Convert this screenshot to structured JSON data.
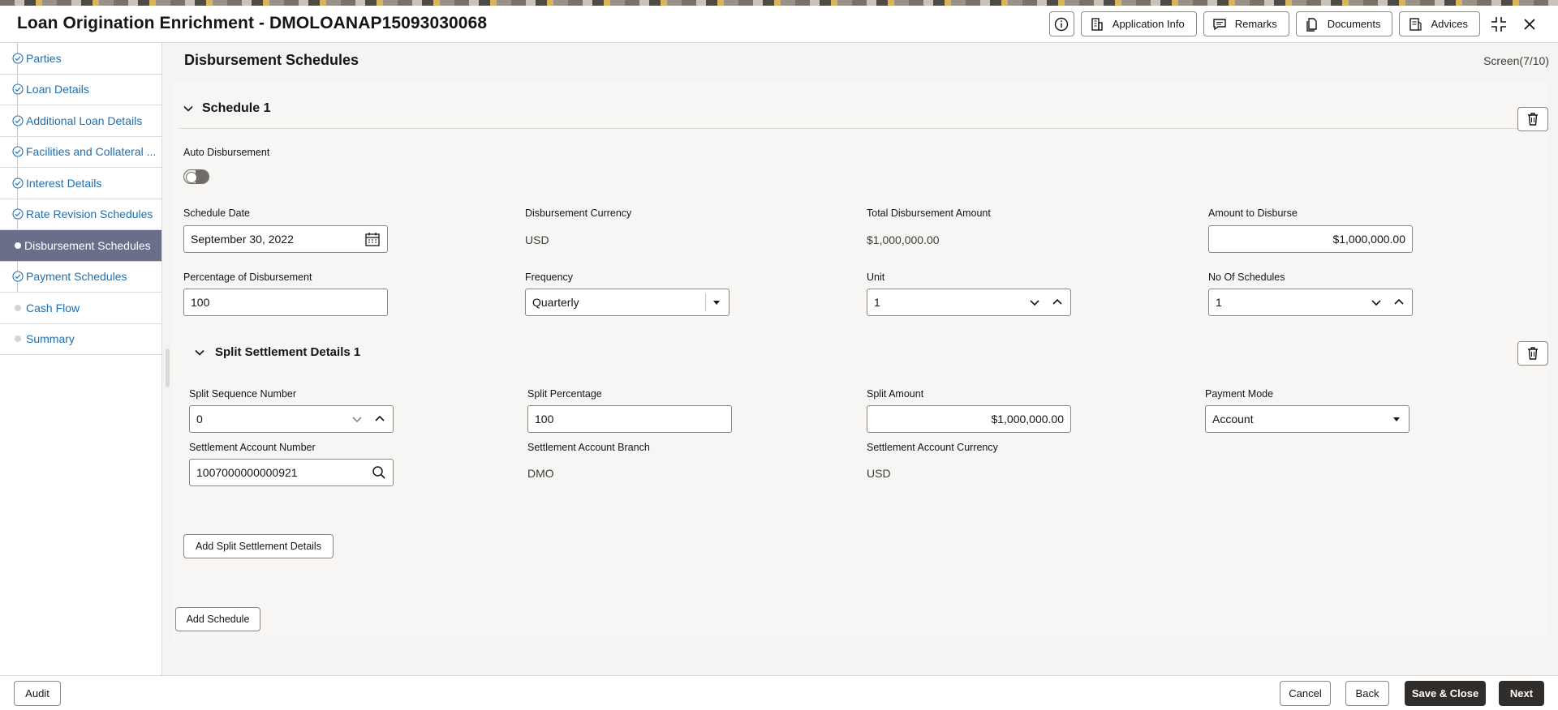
{
  "header": {
    "title": "Loan Origination Enrichment - DMOLOANAP15093030068",
    "buttons": {
      "application_info": "Application Info",
      "remarks": "Remarks",
      "documents": "Documents",
      "advices": "Advices"
    }
  },
  "sidebar": {
    "items": [
      {
        "label": "Parties",
        "state": "done"
      },
      {
        "label": "Loan Details",
        "state": "done"
      },
      {
        "label": "Additional Loan Details",
        "state": "done"
      },
      {
        "label": "Facilities and Collateral ...",
        "state": "done"
      },
      {
        "label": "Interest Details",
        "state": "done"
      },
      {
        "label": "Rate Revision Schedules",
        "state": "done"
      },
      {
        "label": "Disbursement Schedules",
        "state": "active"
      },
      {
        "label": "Payment Schedules",
        "state": "done"
      },
      {
        "label": "Cash Flow",
        "state": "pending"
      },
      {
        "label": "Summary",
        "state": "pending"
      }
    ]
  },
  "main": {
    "page_title": "Disbursement Schedules",
    "screen_count": "Screen(7/10)",
    "schedule": {
      "title": "Schedule 1",
      "auto_disbursement_label": "Auto Disbursement",
      "auto_disbursement_on": false,
      "schedule_date_label": "Schedule Date",
      "schedule_date": "September 30, 2022",
      "currency_label": "Disbursement Currency",
      "currency": "USD",
      "total_amount_label": "Total Disbursement Amount",
      "total_amount": "$1,000,000.00",
      "amount_to_disburse_label": "Amount to Disburse",
      "amount_to_disburse": "$1,000,000.00",
      "percentage_label": "Percentage of Disbursement",
      "percentage": "100",
      "frequency_label": "Frequency",
      "frequency": "Quarterly",
      "unit_label": "Unit",
      "unit": "1",
      "no_of_schedules_label": "No Of Schedules",
      "no_of_schedules": "1"
    },
    "split": {
      "title": "Split Settlement Details 1",
      "seq_label": "Split Sequence Number",
      "seq": "0",
      "pct_label": "Split Percentage",
      "pct": "100",
      "amount_label": "Split Amount",
      "amount": "$1,000,000.00",
      "mode_label": "Payment Mode",
      "mode": "Account",
      "acct_label": "Settlement Account Number",
      "acct": "1007000000000921",
      "branch_label": "Settlement Account Branch",
      "branch": "DMO",
      "acct_ccy_label": "Settlement Account Currency",
      "acct_ccy": "USD"
    },
    "add_split_label": "Add Split Settlement Details",
    "add_schedule_label": "Add Schedule"
  },
  "footer": {
    "audit": "Audit",
    "cancel": "Cancel",
    "back": "Back",
    "save_close": "Save & Close",
    "next": "Next"
  },
  "colors": {
    "link": "#1f6fae",
    "active_sidebar": "#6b6e88",
    "primary_button": "#312d2a"
  }
}
